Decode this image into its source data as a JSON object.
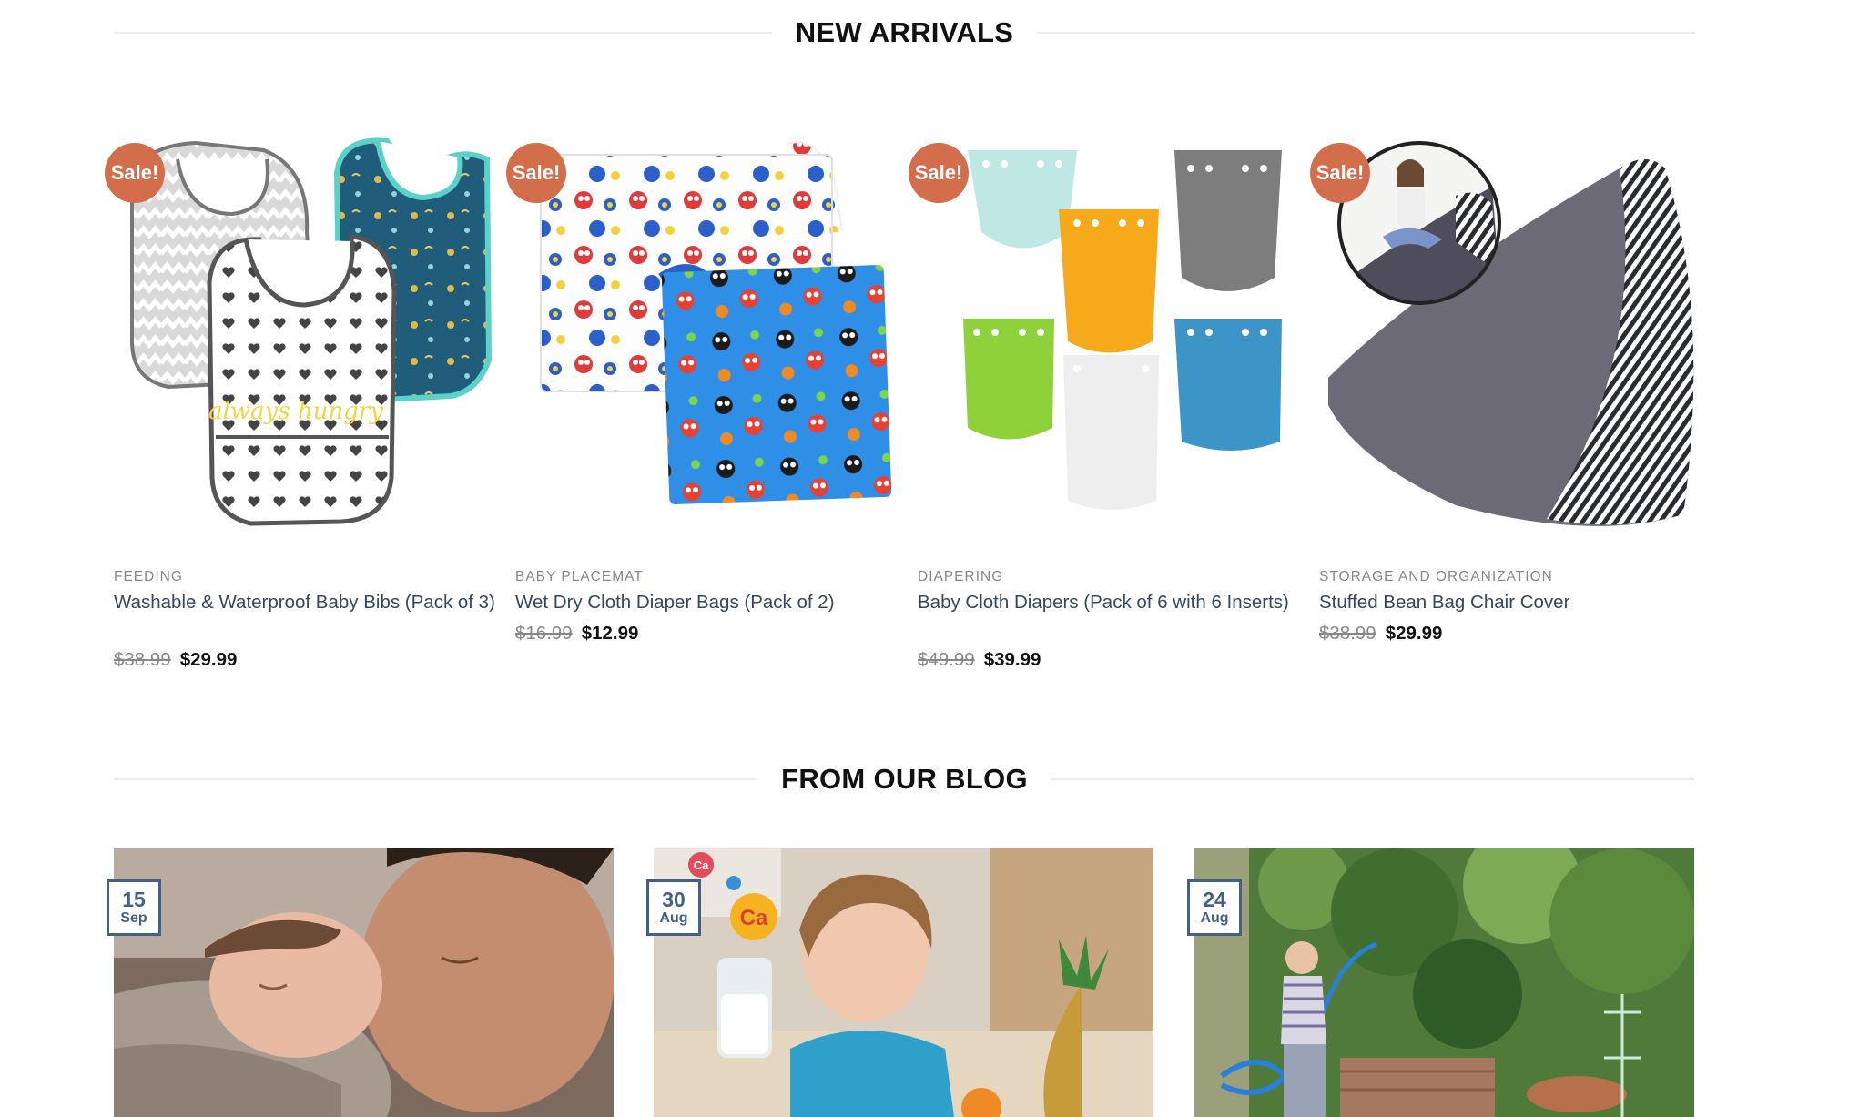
{
  "sections": {
    "new_arrivals_title": "NEW ARRIVALS",
    "blog_title": "FROM OUR BLOG"
  },
  "sale_label": "Sale!",
  "products": [
    {
      "category": "FEEDING",
      "title": "Washable & Waterproof Baby Bibs (Pack of 3)",
      "old_price": "$38.99",
      "price": "$29.99"
    },
    {
      "category": "BABY PLACEMAT",
      "title": "Wet Dry Cloth Diaper Bags (Pack of 2)",
      "old_price": "$16.99",
      "price": "$12.99"
    },
    {
      "category": "DIAPERING",
      "title": "Baby Cloth Diapers (Pack of 6 with 6 Inserts)",
      "old_price": "$49.99",
      "price": "$39.99"
    },
    {
      "category": "STORAGE AND ORGANIZATION",
      "title": "Stuffed Bean Bag Chair Cover",
      "old_price": "$38.99",
      "price": "$29.99"
    }
  ],
  "blog_posts": [
    {
      "day": "15",
      "month": "Sep"
    },
    {
      "day": "30",
      "month": "Aug"
    },
    {
      "day": "24",
      "month": "Aug"
    }
  ],
  "colors": {
    "sale_badge": "#d26e4b",
    "link": "#334862",
    "date_badge": "#446084"
  },
  "illustration_text": {
    "bib_print": "always hungry",
    "calcium_symbol": "Ca"
  }
}
